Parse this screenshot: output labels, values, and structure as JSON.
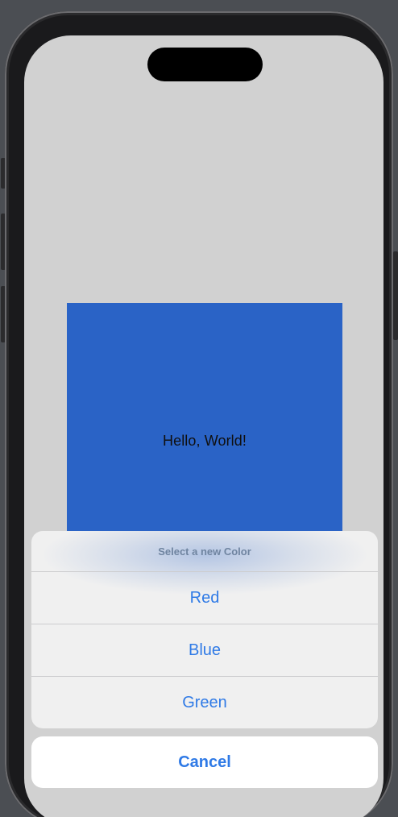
{
  "main": {
    "greeting": "Hello, World!",
    "box_color": "#2a63c6"
  },
  "action_sheet": {
    "title": "Select a new Color",
    "options": [
      {
        "label": "Red"
      },
      {
        "label": "Blue"
      },
      {
        "label": "Green"
      }
    ],
    "cancel_label": "Cancel",
    "tint_color": "#2f7ae6"
  }
}
